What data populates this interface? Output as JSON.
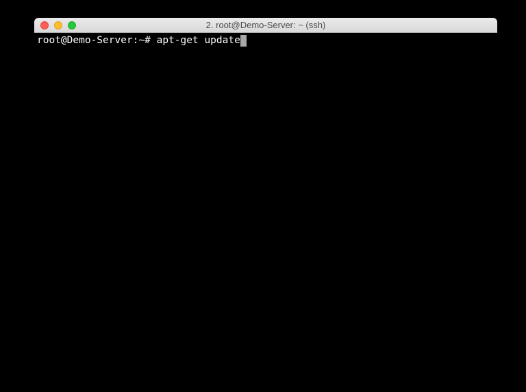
{
  "window": {
    "title": "2. root@Demo-Server: ~ (ssh)"
  },
  "terminal": {
    "prompt": "root@Demo-Server:~# ",
    "command": "apt-get update"
  }
}
